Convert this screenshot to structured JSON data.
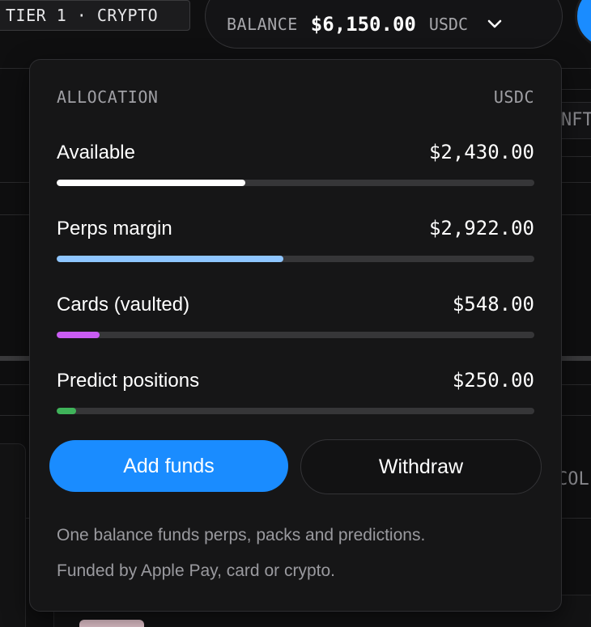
{
  "header": {
    "tier_label": "TIER 1 · CRYPTO",
    "balance_label": "BALANCE",
    "balance_amount": "$6,150.00",
    "balance_currency": "USDC",
    "chevron_icon": "chevron-down-icon",
    "avatar_color": "#1a8cff"
  },
  "background": {
    "chip_nft": "NFT",
    "chip_col": "COL"
  },
  "dropdown": {
    "title": "ALLOCATION",
    "currency": "USDC",
    "items": [
      {
        "label": "Available",
        "amount": "$2,430.00",
        "fraction": 0.3951,
        "color": "#ffffff"
      },
      {
        "label": "Perps margin",
        "amount": "$2,922.00",
        "fraction": 0.4751,
        "color": "#8ec5ff"
      },
      {
        "label": "Cards (vaulted)",
        "amount": "$548.00",
        "fraction": 0.0891,
        "color": "#c95cf2"
      },
      {
        "label": "Predict positions",
        "amount": "$250.00",
        "fraction": 0.0407,
        "color": "#3fb35a"
      }
    ],
    "add_funds_label": "Add funds",
    "withdraw_label": "Withdraw",
    "note_line1": "One balance funds perps, packs and predictions.",
    "note_line2": "Funded by Apple Pay, card or crypto."
  }
}
